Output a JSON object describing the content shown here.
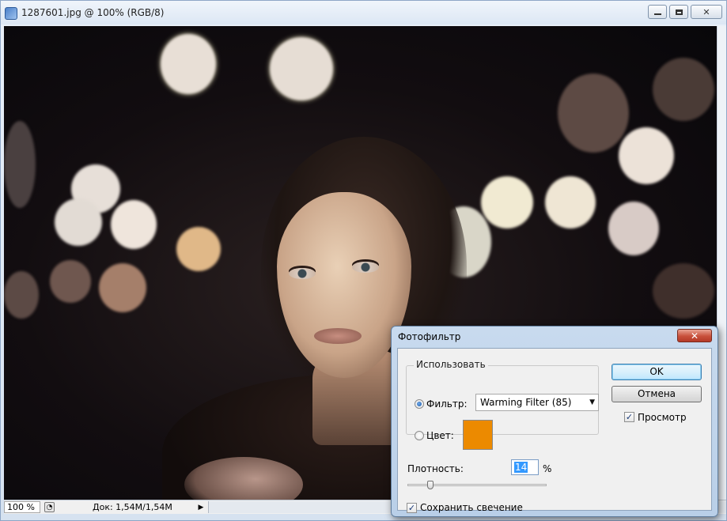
{
  "window": {
    "title": "1287601.jpg @ 100% (RGB/8)",
    "icon": "photoshop-doc-icon"
  },
  "statusbar": {
    "zoom": "100 %",
    "doc_info": "Док: 1,54M/1,54M",
    "arrow": "▶"
  },
  "dialog": {
    "title": "Фотофильтр",
    "close_label": "✕",
    "use_group": {
      "legend": "Использовать",
      "filter_label": "Фильтр:",
      "filter_selected": "Warming Filter (85)",
      "filter_checked": true,
      "color_label": "Цвет:",
      "color_checked": false,
      "color_value": "#ec8a00"
    },
    "ok_label": "OK",
    "cancel_label": "Отмена",
    "preview_label": "Просмотр",
    "preview_checked": true,
    "density_label": "Плотность:",
    "density_value": "14",
    "density_unit": "%",
    "density_percent": 14,
    "preserve_label": "Сохранить свечение",
    "preserve_checked": true
  }
}
